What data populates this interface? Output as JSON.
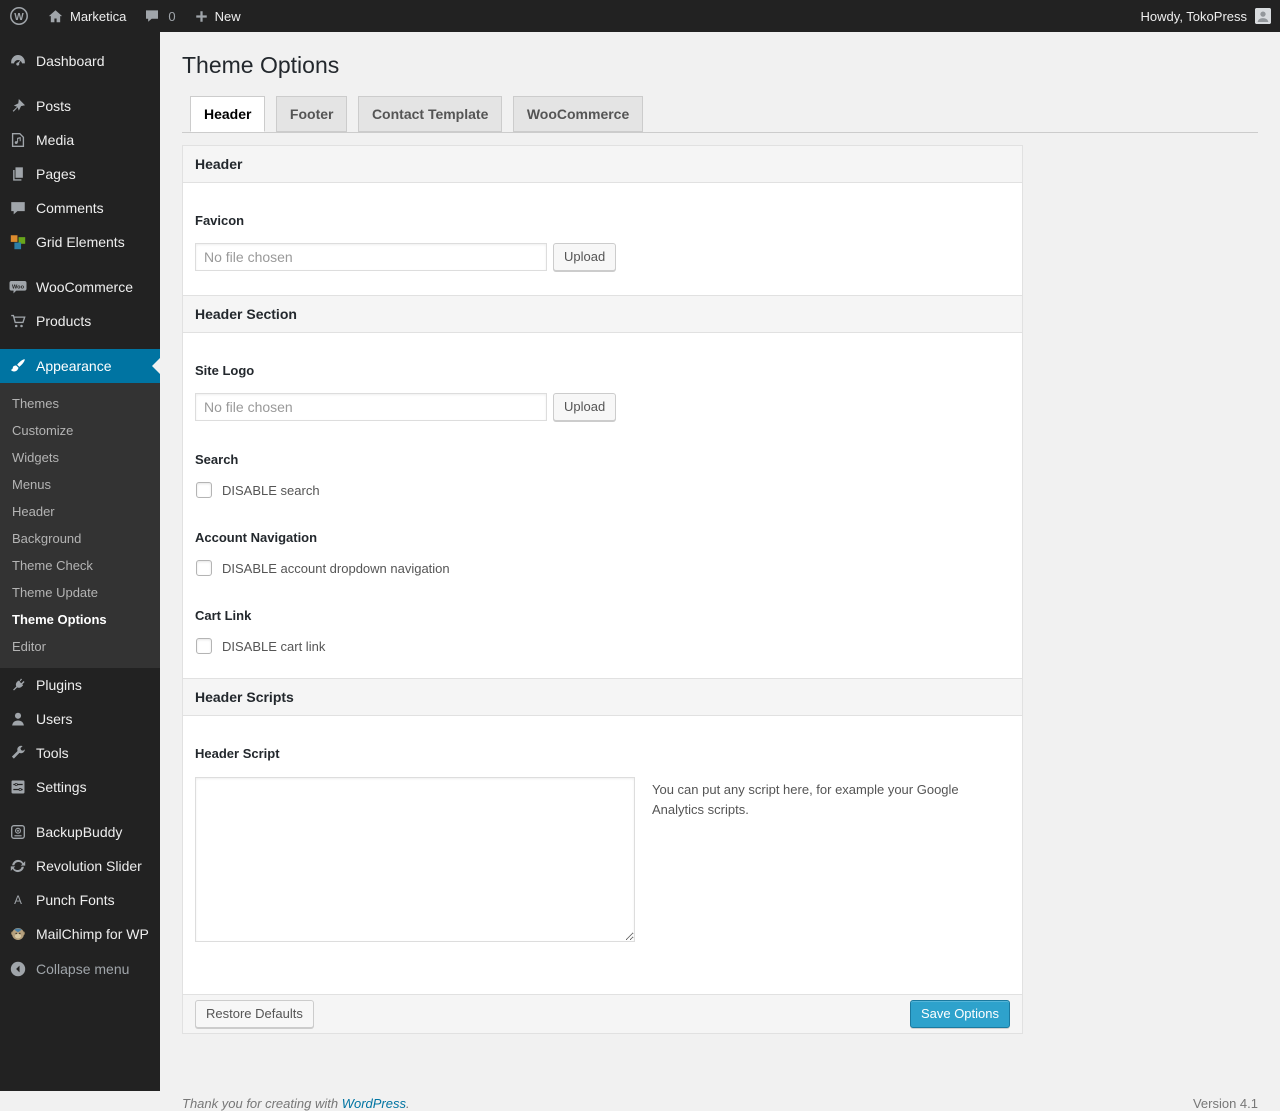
{
  "admin_bar": {
    "site_name": "Marketica",
    "comment_count": "0",
    "new_label": "New",
    "howdy": "Howdy, TokoPress"
  },
  "sidebar": {
    "items": [
      {
        "label": "Dashboard",
        "icon": "dashboard-icon"
      },
      {
        "label": "Posts",
        "icon": "pushpin-icon"
      },
      {
        "label": "Media",
        "icon": "media-icon"
      },
      {
        "label": "Pages",
        "icon": "pages-icon"
      },
      {
        "label": "Comments",
        "icon": "comment-icon"
      },
      {
        "label": "Grid Elements",
        "icon": "grid-icon"
      },
      {
        "label": "WooCommerce",
        "icon": "woo-badge-icon"
      },
      {
        "label": "Products",
        "icon": "cart-icon"
      },
      {
        "label": "Appearance",
        "icon": "brush-icon",
        "active": true
      },
      {
        "label": "Plugins",
        "icon": "plug-icon"
      },
      {
        "label": "Users",
        "icon": "user-icon"
      },
      {
        "label": "Tools",
        "icon": "wrench-icon"
      },
      {
        "label": "Settings",
        "icon": "sliders-icon"
      },
      {
        "label": "BackupBuddy",
        "icon": "backup-icon"
      },
      {
        "label": "Revolution Slider",
        "icon": "refresh-icon"
      },
      {
        "label": "Punch Fonts",
        "icon": "letter-a-icon"
      },
      {
        "label": "MailChimp for WP",
        "icon": "monkey-icon"
      },
      {
        "label": "Collapse menu",
        "icon": "collapse-icon"
      }
    ],
    "appearance_submenu": [
      {
        "label": "Themes"
      },
      {
        "label": "Customize"
      },
      {
        "label": "Widgets"
      },
      {
        "label": "Menus"
      },
      {
        "label": "Header"
      },
      {
        "label": "Background"
      },
      {
        "label": "Theme Check"
      },
      {
        "label": "Theme Update"
      },
      {
        "label": "Theme Options",
        "current": true
      },
      {
        "label": "Editor"
      }
    ]
  },
  "page": {
    "title": "Theme Options"
  },
  "tabs": [
    {
      "label": "Header",
      "active": true
    },
    {
      "label": "Footer"
    },
    {
      "label": "Contact Template"
    },
    {
      "label": "WooCommerce"
    }
  ],
  "panel": {
    "section1_title": "Header",
    "favicon_label": "Favicon",
    "favicon_value": "No file chosen",
    "upload_label": "Upload",
    "section2_title": "Header Section",
    "site_logo_label": "Site Logo",
    "site_logo_value": "No file chosen",
    "search_label": "Search",
    "search_checkbox_label": "DISABLE search",
    "account_label": "Account Navigation",
    "account_checkbox_label": "DISABLE account dropdown navigation",
    "cart_label": "Cart Link",
    "cart_checkbox_label": "DISABLE cart link",
    "section3_title": "Header Scripts",
    "script_label": "Header Script",
    "script_value": "",
    "script_help": "You can put any script here, for example your Google Analytics scripts.",
    "restore_label": "Restore Defaults",
    "save_label": "Save Options"
  },
  "footer": {
    "thanks": "Thank you for creating with",
    "link_label": "WordPress",
    "suffix": ".",
    "version": "Version 4.1"
  },
  "colors": {
    "admin_bar_bg": "#222222",
    "submenu_bg": "#333333",
    "menu_highlight": "#0074a2",
    "primary_button": "#2ea2cc",
    "page_bg": "#f1f1f1",
    "link": "#0074a2"
  }
}
